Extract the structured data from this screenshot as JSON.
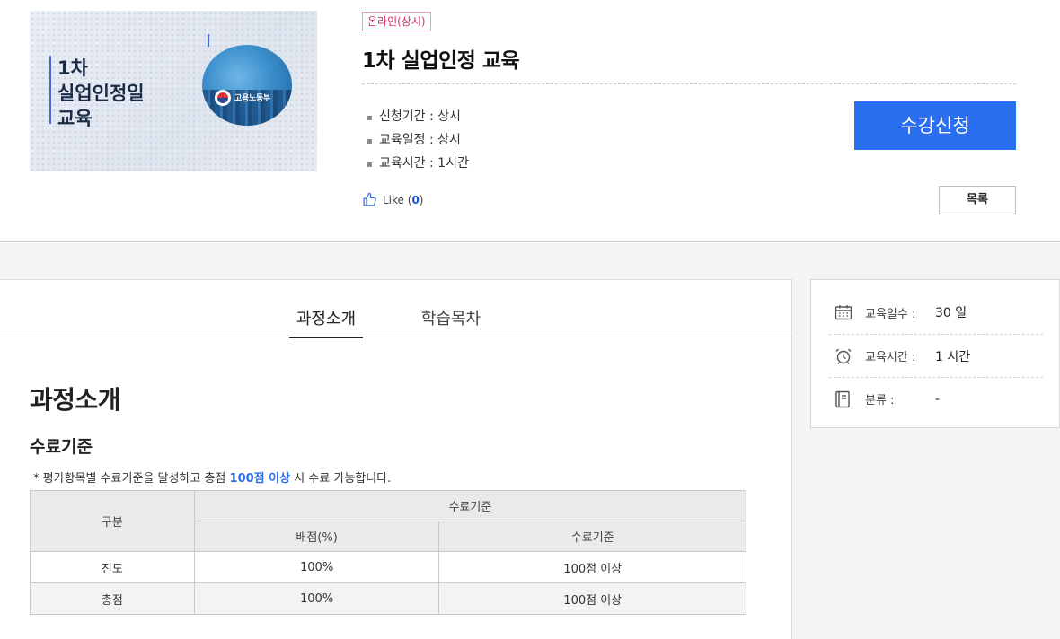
{
  "thumbnail": {
    "title": "1차\n실업인정일\n교육",
    "ministry": "고용노동부"
  },
  "course": {
    "badge": "온라인(상시)",
    "title": "1차 실업인정 교육",
    "info": [
      {
        "label": "신청기간",
        "value": "상시"
      },
      {
        "label": "교육일정",
        "value": "상시"
      },
      {
        "label": "교육시간",
        "value": "1시간"
      }
    ],
    "apply_label": "수강신청",
    "like_label": "Like",
    "like_count": "0",
    "list_label": "목록"
  },
  "tabs": [
    {
      "label": "과정소개",
      "active": true
    },
    {
      "label": "학습목차",
      "active": false
    }
  ],
  "content": {
    "section_title": "과정소개",
    "sub_title": "수료기준",
    "note_prefix": "* 평가항목별 수료기준을 달성하고 총점 ",
    "note_highlight": "100점 이상",
    "note_suffix": " 시 수료 가능합니다.",
    "table": {
      "header_col": "구분",
      "header_group": "수료기준",
      "sub_headers": [
        "배점(%)",
        "수료기준"
      ],
      "rows": [
        {
          "category": "진도",
          "score": "100%",
          "criterion": "100점 이상"
        },
        {
          "category": "총점",
          "score": "100%",
          "criterion": "100점 이상"
        }
      ]
    }
  },
  "side": {
    "rows": [
      {
        "icon": "calendar-icon",
        "label": "교육일수 :",
        "value": "30 일"
      },
      {
        "icon": "alarm-clock-icon",
        "label": "교육시간 :",
        "value": "1 시간"
      },
      {
        "icon": "book-icon",
        "label": "분류 :",
        "value": "-"
      }
    ]
  },
  "colors": {
    "accent": "#2a6ff0",
    "badge": "#d3336f"
  }
}
